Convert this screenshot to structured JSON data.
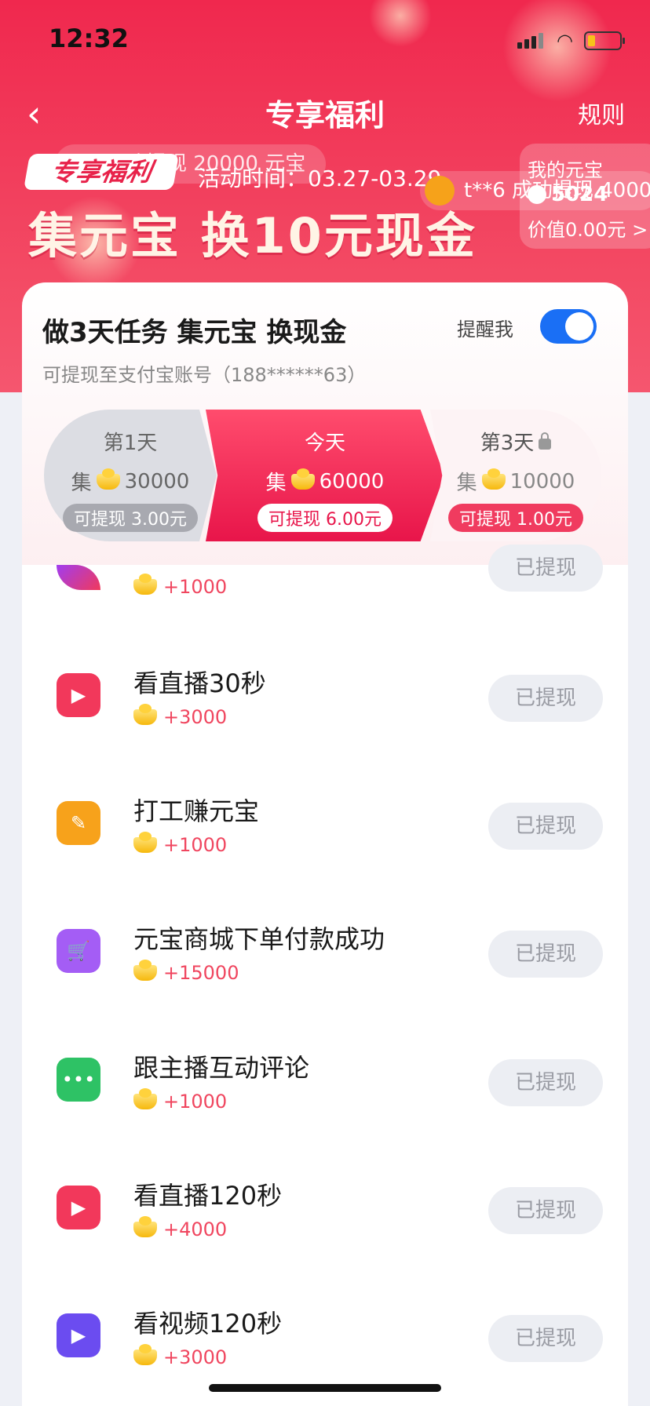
{
  "status": {
    "time": "12:32"
  },
  "nav": {
    "title": "专享福利",
    "rules": "规则"
  },
  "banner": {
    "ticker_top": "功提现 20000 元宝",
    "ticker_bottom": "t**6 成功提现 4000",
    "badge": "专享福利",
    "activity_time": "活动时间：03.27-03.29",
    "headline": "集元宝 换10元现金"
  },
  "wallet": {
    "label": "我的元宝",
    "amount": "5024",
    "value": "价值0.00元 >"
  },
  "card": {
    "title": "做3天任务 集元宝 换现金",
    "remind_label": "提醒我",
    "remind_on": true,
    "subtitle": "可提现至支付宝账号（188******63）"
  },
  "days": [
    {
      "name": "第1天",
      "goal_prefix": "集",
      "goal": "30000",
      "withdraw": "可提现 3.00元",
      "locked": false
    },
    {
      "name": "今天",
      "goal_prefix": "集",
      "goal": "60000",
      "withdraw": "可提现 6.00元",
      "locked": false
    },
    {
      "name": "第3天",
      "goal_prefix": "集",
      "goal": "10000",
      "withdraw": "可提现 1.00元",
      "locked": true
    }
  ],
  "tasks": [
    {
      "name": "",
      "reward": "+1000",
      "button": "已提现",
      "icon": "feather-icon",
      "color": "#e83e8c"
    },
    {
      "name": "看直播30秒",
      "reward": "+3000",
      "button": "已提现",
      "icon": "play-icon",
      "color": "#f2385b"
    },
    {
      "name": "打工赚元宝",
      "reward": "+1000",
      "button": "已提现",
      "icon": "brush-icon",
      "color": "#f7a21b"
    },
    {
      "name": "元宝商城下单付款成功",
      "reward": "+15000",
      "button": "已提现",
      "icon": "cart-icon",
      "color": "#a45df5"
    },
    {
      "name": "跟主播互动评论",
      "reward": "+1000",
      "button": "已提现",
      "icon": "chat-icon",
      "color": "#2ec265"
    },
    {
      "name": "看直播120秒",
      "reward": "+4000",
      "button": "已提现",
      "icon": "play-icon",
      "color": "#f2385b"
    },
    {
      "name": "看视频120秒",
      "reward": "+3000",
      "button": "已提现",
      "icon": "play-icon",
      "color": "#6b4cf0"
    }
  ]
}
